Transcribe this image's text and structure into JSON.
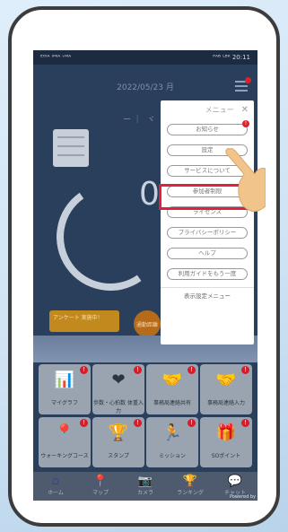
{
  "status_bar": {
    "left": "ᴱᴼᴵᴬ ᴵᴹᴵᴬ ᵛᴹᴬ",
    "right": "ᴾᴬᴮ ᴸᴮᴷ 20:11"
  },
  "date": "2022/05/23 月",
  "subtitle": "ー ︳ヾ",
  "big_number": "0",
  "banner_text": "アンケート 実施中！",
  "round_button": "通勤距離",
  "menu": {
    "title": "メニュー",
    "close": "✕",
    "items": [
      {
        "label": "お知らせ",
        "badge": "!"
      },
      {
        "label": "設定"
      },
      {
        "label": "サービスについて"
      },
      {
        "label": "参加者制限"
      },
      {
        "label": "ライセンス"
      },
      {
        "label": "プライバシーポリシー"
      },
      {
        "label": "ヘルプ"
      },
      {
        "label": "利用ガイドをもう一度"
      }
    ],
    "display_setting": "表示設定メニュー"
  },
  "tiles": [
    {
      "label": "マイグラフ",
      "glyph": "📊",
      "badge": "!"
    },
    {
      "label": "歩数・心拍数 体重入力",
      "glyph": "❤",
      "badge": "!"
    },
    {
      "label": "事務局連絡共有",
      "glyph": "🤝",
      "badge": "!"
    },
    {
      "label": "事務局連絡入力",
      "glyph": "🤝",
      "badge": "!"
    },
    {
      "label": "ウォーキングコース",
      "glyph": "📍",
      "badge": "!"
    },
    {
      "label": "スタンプ",
      "glyph": "🏆",
      "badge": "!"
    },
    {
      "label": "ミッション",
      "glyph": "🏃",
      "badge": "!"
    },
    {
      "label": "SOポイント",
      "glyph": "🎁",
      "badge": "!"
    }
  ],
  "nav": [
    {
      "label": "ホーム",
      "glyph": "⌂"
    },
    {
      "label": "マップ",
      "glyph": "📍"
    },
    {
      "label": "カメラ",
      "glyph": "📷"
    },
    {
      "label": "ランキング",
      "glyph": "🏆"
    },
    {
      "label": "チャット",
      "glyph": "💬"
    }
  ],
  "watermark": "Powered by"
}
